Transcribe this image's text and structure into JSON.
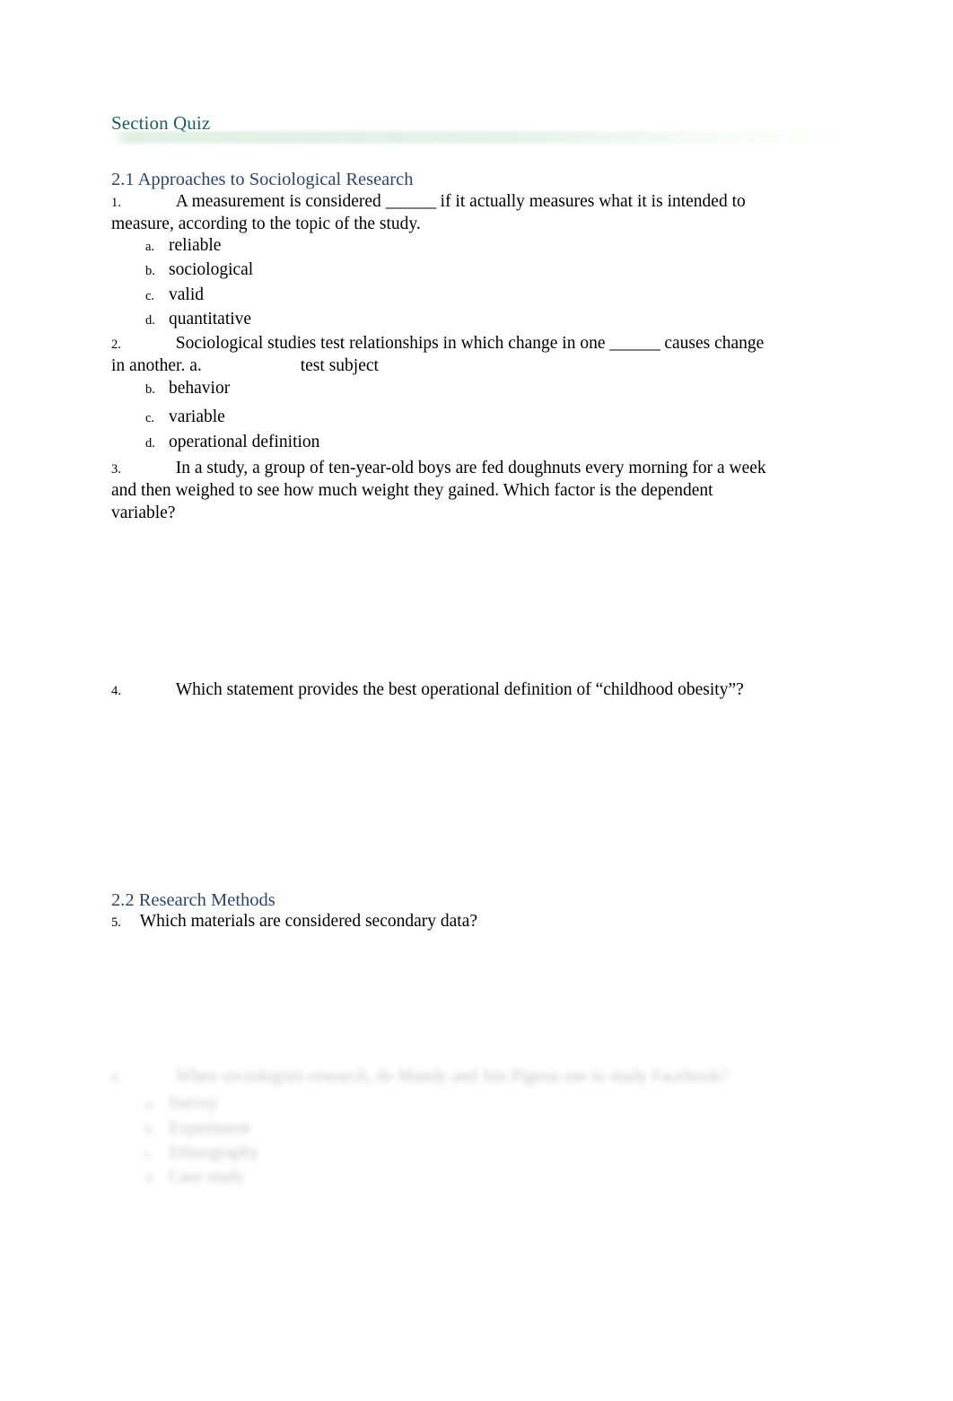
{
  "document": {
    "title": "Section Quiz",
    "title_color": "#1a6060",
    "heading_color": "#2e4372",
    "body_color": "#000000",
    "background": "#ffffff"
  },
  "sections": [
    {
      "id": "2.1",
      "heading": "2.1 Approaches to Sociological Research"
    },
    {
      "id": "2.2",
      "heading": "2.2 Research Methods"
    }
  ],
  "questions": [
    {
      "number": "1.",
      "text": "A measurement is considered ______ if it actually measures what it is intended to measure, according to the topic of the study.",
      "text_part_1": "A measurement is considered ",
      "blank": "______",
      "text_part_2": " if it actually measures what it is intended to measure, according to the topic of the study.",
      "options": [
        {
          "letter": "a.",
          "text": "reliable"
        },
        {
          "letter": "b.",
          "text": "sociological"
        },
        {
          "letter": "c.",
          "text": "valid"
        },
        {
          "letter": "d.",
          "text": "quantitative"
        }
      ]
    },
    {
      "number": "2.",
      "text": "Sociological studies test relationships in which change in one ______ causes change in another.",
      "text_part_1": "Sociological studies test relationships in which change in one ",
      "blank": "______",
      "text_part_2": " causes change in another. ",
      "inline_option_letter": "a.",
      "inline_option_text": "test subject",
      "options": [
        {
          "letter": "b.",
          "text": "behavior"
        },
        {
          "letter": "c.",
          "text": "variable"
        },
        {
          "letter": "d.",
          "text": "operational definition"
        }
      ]
    },
    {
      "number": "3.",
      "text": "In a study, a group of ten-year-old boys are fed doughnuts every morning for a week and then weighed to see how much weight they gained. Which factor is the dependent variable?"
    },
    {
      "number": "4.",
      "text": "Which statement provides the best operational definition of “childhood obesity”?"
    },
    {
      "number": "5.",
      "text": "Which materials are considered secondary data?"
    }
  ],
  "faded_question": {
    "number": "6.",
    "text": "When sociologists research, do Mandy and Jim Pigeon use to study Facebook?",
    "options": [
      {
        "letter": "a.",
        "text": "Survey"
      },
      {
        "letter": "b.",
        "text": "Experiment"
      },
      {
        "letter": "c.",
        "text": "Ethnography"
      },
      {
        "letter": "d.",
        "text": "Case study"
      }
    ]
  }
}
